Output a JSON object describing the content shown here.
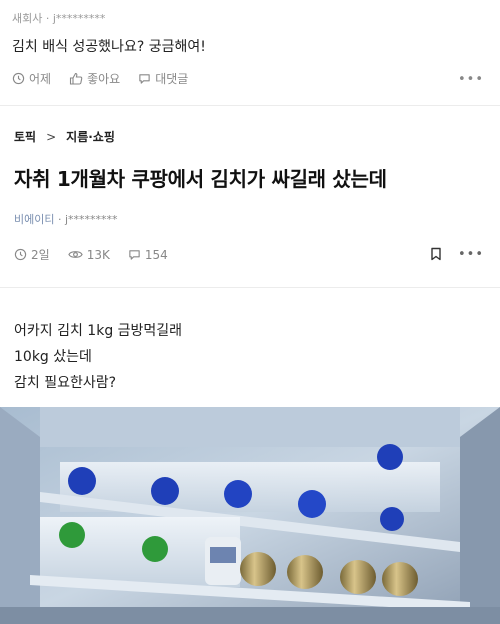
{
  "comment": {
    "author": "새회사 · j*********",
    "body": "김치 배식 성공했나요? 궁금해여!",
    "time": "어제",
    "like_label": "좋아요",
    "reply_label": "대댓글"
  },
  "post": {
    "breadcrumb": {
      "topic": "토픽",
      "separator": ">",
      "category": "지름·쇼핑"
    },
    "title": "자취 1개월차 쿠팡에서 김치가 싸길래 샀는데",
    "meta": {
      "company": "비에이티",
      "dot": " · ",
      "user": "j*********"
    },
    "stats": {
      "time": "2일",
      "views": "13K",
      "comments": "154"
    },
    "body_lines": [
      "어카지 김치 1kg 금방먹길래",
      "10kg 샀는데",
      "감치 필요한사람?"
    ]
  },
  "photo": {
    "description_icon": "fridge-photo"
  },
  "colors": {
    "meta_company": "#7a8fb0",
    "muted": "#888888",
    "text": "#222222"
  }
}
